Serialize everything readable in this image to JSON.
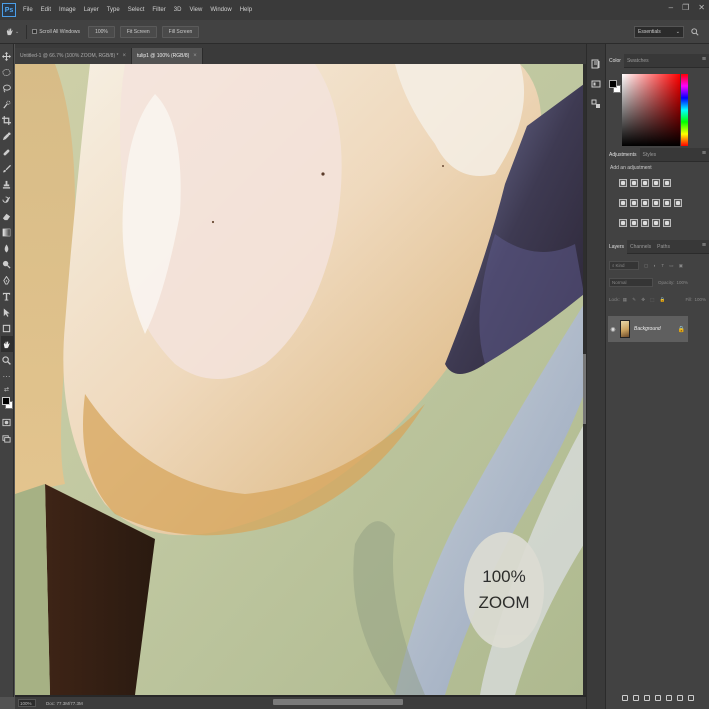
{
  "app": {
    "logo": "Ps"
  },
  "menu": [
    "File",
    "Edit",
    "Image",
    "Layer",
    "Type",
    "Select",
    "Filter",
    "3D",
    "View",
    "Window",
    "Help"
  ],
  "window_controls": {
    "minimize": "–",
    "restore": "❐",
    "close": "✕"
  },
  "options": {
    "scroll_all_windows": "Scroll All Windows",
    "zoom_100": "100%",
    "fit_screen": "Fit Screen",
    "fill_screen": "Fill Screen",
    "workspace": "Essentials"
  },
  "tabs": [
    {
      "label": "Untitled-1 @ 66.7% (100% ZOOM, RGB/8) *",
      "close": "×"
    },
    {
      "label": "tulip1 @ 100% (RGB/8)",
      "close": "×"
    }
  ],
  "canvas": {
    "badge_line1": "100%",
    "badge_line2": "ZOOM"
  },
  "status": {
    "zoom": "100%",
    "doc": "Doc: 77.3M/77.3M"
  },
  "color_panel": {
    "tabs": [
      "Color",
      "Swatches"
    ]
  },
  "adjustments_panel": {
    "tabs": [
      "Adjustments",
      "Styles"
    ],
    "title": "Add an adjustment"
  },
  "layers_panel": {
    "tabs": [
      "Layers",
      "Channels",
      "Paths"
    ],
    "filter_kind": "Kind",
    "blend_mode": "Normal",
    "opacity_label": "Opacity:",
    "opacity_value": "100%",
    "lock_label": "Lock:",
    "fill_label": "Fill:",
    "fill_value": "100%",
    "layer_name": "Background"
  },
  "colors": {
    "accent": "#4fa6f0",
    "foreground": "#000000",
    "background": "#ffffff"
  }
}
